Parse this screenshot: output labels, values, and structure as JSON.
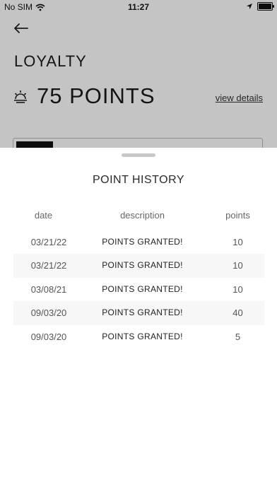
{
  "status_bar": {
    "carrier": "No SIM",
    "time": "11:27"
  },
  "page": {
    "title": "LOYALTY",
    "points": "75 POINTS",
    "view_details": "view details"
  },
  "sheet": {
    "title": "POINT HISTORY",
    "columns": {
      "date": "date",
      "description": "description",
      "points": "points"
    },
    "rows": [
      {
        "date": "03/21/22",
        "description": "POINTS GRANTED!",
        "points": "10"
      },
      {
        "date": "03/21/22",
        "description": "POINTS GRANTED!",
        "points": "10"
      },
      {
        "date": "03/08/21",
        "description": "POINTS GRANTED!",
        "points": "10"
      },
      {
        "date": "09/03/20",
        "description": "POINTS GRANTED!",
        "points": "40"
      },
      {
        "date": "09/03/20",
        "description": "POINTS GRANTED!",
        "points": "5"
      }
    ]
  },
  "icons": {
    "wifi": "wifi-icon",
    "location": "location-arrow-icon",
    "battery": "battery-icon",
    "back": "back-arrow-icon",
    "points": "points-sun-icon"
  },
  "colors": {
    "overlay": "#000000",
    "row_alt": "#f7f7f7",
    "text": "#222222"
  }
}
